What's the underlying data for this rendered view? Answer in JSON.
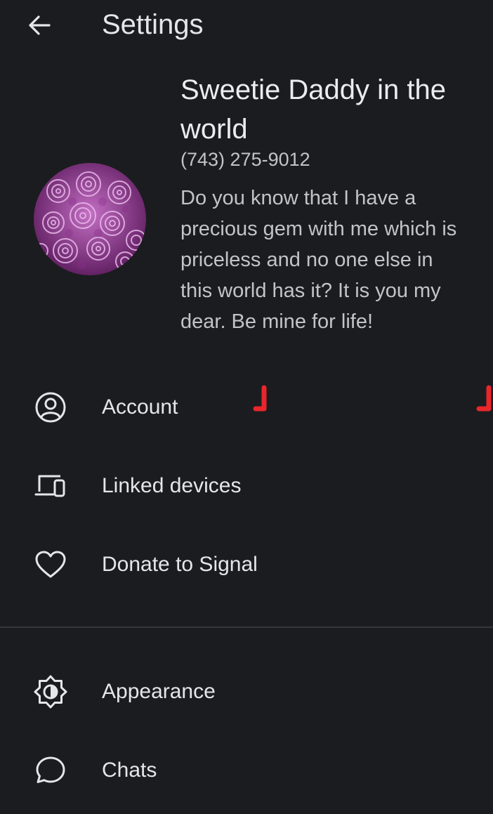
{
  "colors": {
    "background": "#1b1c1f",
    "text_primary": "#e6e6e9",
    "text_secondary": "#c3c3c8",
    "divider": "#35363a",
    "annotation_red": "#e8262b"
  },
  "header": {
    "back_icon": "arrow-left-icon",
    "title": "Settings"
  },
  "profile": {
    "avatar": "purple-roses-photo",
    "name": "Sweetie Daddy in the world",
    "phone": "(743) 275-9012",
    "about": "Do you know that I have a precious gem with me which is priceless and no one else in this world has it? It is you my dear. Be mine for life!"
  },
  "menu": {
    "items": [
      {
        "label": "Account",
        "icon": "account-circle-icon"
      },
      {
        "label": "Linked devices",
        "icon": "devices-icon"
      },
      {
        "label": "Donate to Signal",
        "icon": "heart-icon"
      },
      {
        "label": "Appearance",
        "icon": "brightness-icon"
      },
      {
        "label": "Chats",
        "icon": "chat-bubble-icon"
      }
    ]
  }
}
